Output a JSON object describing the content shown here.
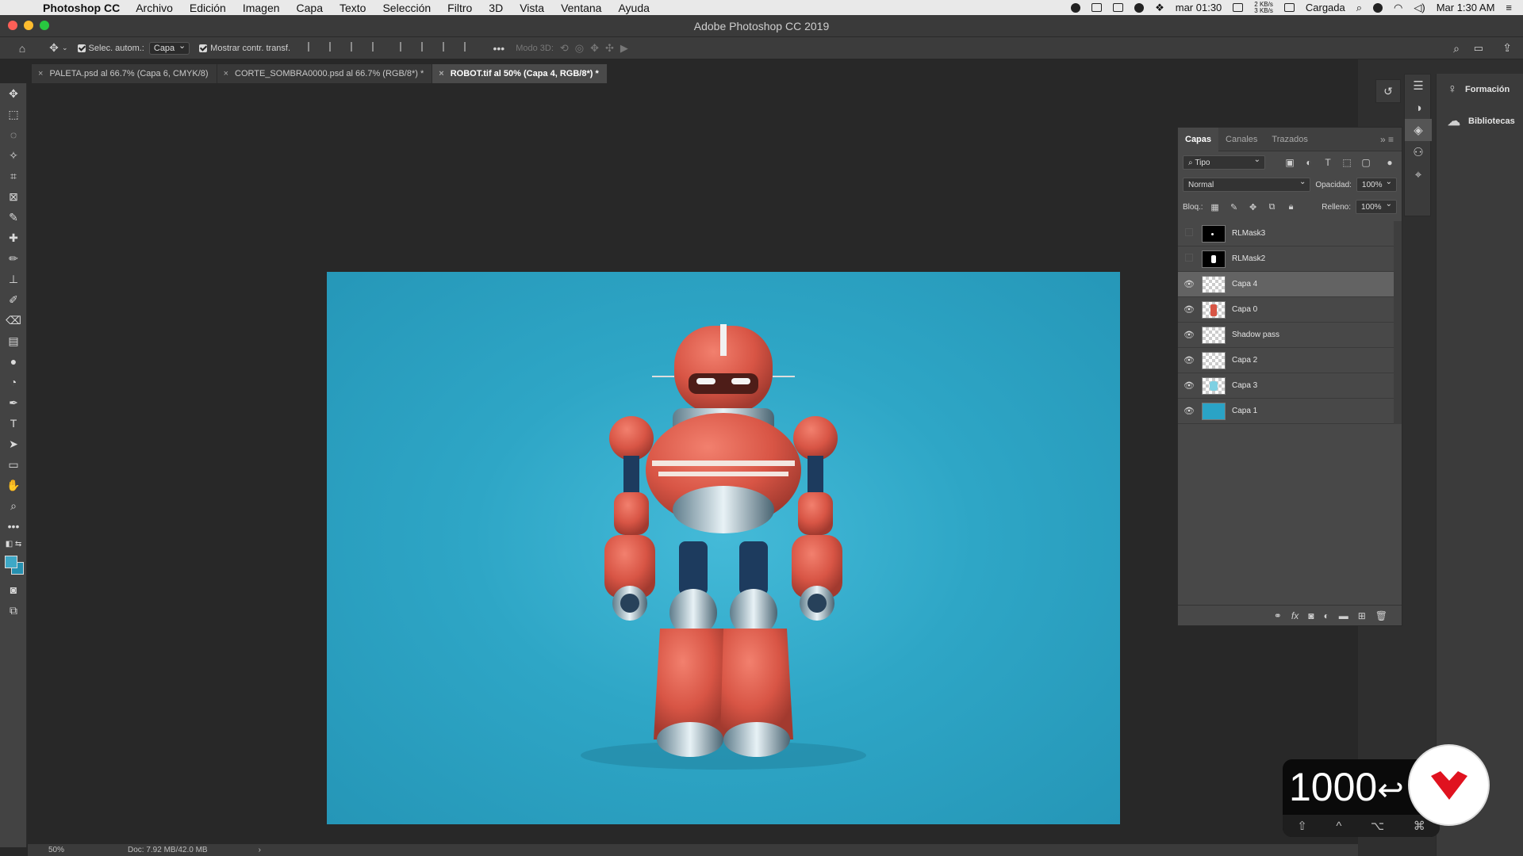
{
  "menubar": {
    "app": "Photoshop CC",
    "menus": [
      "Archivo",
      "Edición",
      "Imagen",
      "Capa",
      "Texto",
      "Selección",
      "Filtro",
      "3D",
      "Vista",
      "Ventana",
      "Ayuda"
    ],
    "clock_small": "mar 01:30",
    "net_up": "2 KB/s",
    "net_down": "3 KB/s",
    "battery": "Cargada",
    "time": "Mar 1:30 AM"
  },
  "window": {
    "title": "Adobe Photoshop CC 2019"
  },
  "options": {
    "auto_select_label": "Selec. autom.:",
    "auto_select_value": "Capa",
    "transform_label": "Mostrar contr. transf.",
    "mode3d": "Modo 3D:"
  },
  "tabs": [
    {
      "label": "PALETA.psd al 66.7% (Capa 6, CMYK/8)"
    },
    {
      "label": "CORTE_SOMBRA0000.psd al 66.7% (RGB/8*) *"
    },
    {
      "label": "ROBOT.tif al 50% (Capa 4, RGB/8*) *"
    }
  ],
  "status": {
    "zoom": "50%",
    "doc": "Doc: 7.92 MB/42.0 MB",
    "arrow": "›"
  },
  "side": {
    "formacion": "Formación",
    "bibliotecas": "Bibliotecas"
  },
  "layers_panel": {
    "tabs": [
      "Capas",
      "Canales",
      "Trazados"
    ],
    "filter": "Tipo",
    "blend": "Normal",
    "opacity_label": "Opacidad:",
    "opacity": "100%",
    "lock_label": "Bloq.:",
    "fill_label": "Relleno:",
    "fill": "100%",
    "layers": [
      {
        "name": "RLMask3",
        "visible": false,
        "thumb": "black-dot"
      },
      {
        "name": "RLMask2",
        "visible": false,
        "thumb": "black-figure"
      },
      {
        "name": "Capa 4",
        "visible": true,
        "thumb": "checker",
        "selected": true
      },
      {
        "name": "Capa 0",
        "visible": true,
        "thumb": "robot"
      },
      {
        "name": "Shadow pass",
        "visible": true,
        "thumb": "checker"
      },
      {
        "name": "Capa 2",
        "visible": true,
        "thumb": "checker"
      },
      {
        "name": "Capa 3",
        "visible": true,
        "thumb": "cyan"
      },
      {
        "name": "Capa 1",
        "visible": true,
        "thumb": "blue"
      }
    ]
  },
  "overlay": {
    "number": "1000",
    "keys": [
      "⇧",
      "^",
      "⌥",
      "⌘"
    ]
  },
  "colors": {
    "canvas": "#2ea6c6",
    "robot": "#d85545",
    "foreground": "#3ea8c6",
    "background": "#2690b0"
  }
}
